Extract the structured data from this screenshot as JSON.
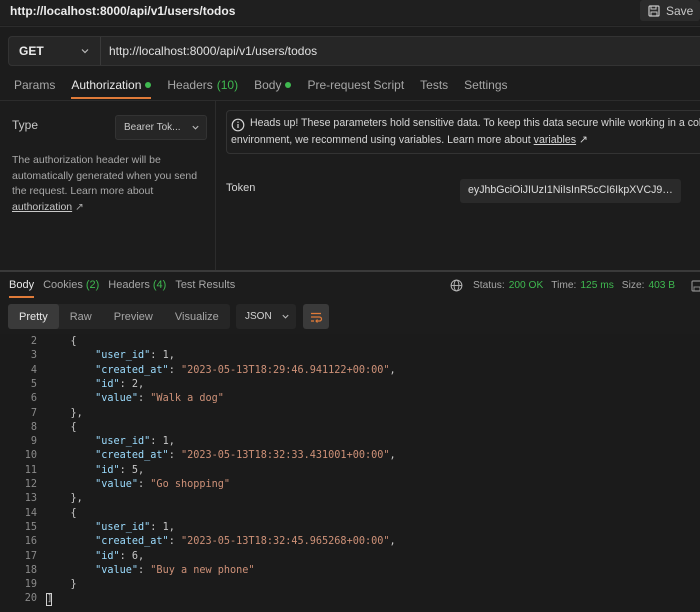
{
  "window": {
    "title": "http://localhost:8000/api/v1/users/todos",
    "save_label": "Save"
  },
  "request": {
    "method": "GET",
    "url": "http://localhost:8000/api/v1/users/todos"
  },
  "request_tabs": [
    {
      "label": "Params"
    },
    {
      "label": "Authorization"
    },
    {
      "label": "Headers",
      "count": "(10)"
    },
    {
      "label": "Body"
    },
    {
      "label": "Pre-request Script"
    },
    {
      "label": "Tests"
    },
    {
      "label": "Settings"
    }
  ],
  "auth": {
    "type_label": "Type",
    "type_value": "Bearer Tok...",
    "desc_1": "The authorization header will be automatically generated when you send the request. Learn more about ",
    "desc_link": "authorization",
    "notice_line1": "Heads up! These parameters hold sensitive data. To keep this data secure while working in a collabor",
    "notice_line2": "environment, we recommend using variables. Learn more about ",
    "notice_link": "variables",
    "token_label": "Token",
    "token_value": "eyJhbGciOiJIUzI1NiIsInR5cCI6IkpXVCJ9.ey..."
  },
  "response_tabs": [
    {
      "label": "Body"
    },
    {
      "label": "Cookies",
      "count": "(2)"
    },
    {
      "label": "Headers",
      "count": "(4)"
    },
    {
      "label": "Test Results"
    }
  ],
  "status": {
    "status_label": "Status:",
    "status_value": "200 OK",
    "time_label": "Time:",
    "time_value": "125 ms",
    "size_label": "Size:",
    "size_value": "403 B",
    "save_truncated": "Sa"
  },
  "views": [
    "Pretty",
    "Raw",
    "Preview",
    "Visualize"
  ],
  "format": "JSON",
  "code_lines": [
    {
      "n": "2",
      "text": "    {"
    },
    {
      "n": "3",
      "key": "\"user_id\"",
      "val": "1",
      "kind": "num"
    },
    {
      "n": "4",
      "key": "\"created_at\"",
      "val": "\"2023-05-13T18:29:46.941122+00:00\"",
      "kind": "str"
    },
    {
      "n": "5",
      "key": "\"id\"",
      "val": "2",
      "kind": "num"
    },
    {
      "n": "6",
      "key": "\"value\"",
      "val": "\"Walk a dog\"",
      "kind": "str",
      "last": true
    },
    {
      "n": "7",
      "text": "    },"
    },
    {
      "n": "8",
      "text": "    {"
    },
    {
      "n": "9",
      "key": "\"user_id\"",
      "val": "1",
      "kind": "num"
    },
    {
      "n": "10",
      "key": "\"created_at\"",
      "val": "\"2023-05-13T18:32:33.431001+00:00\"",
      "kind": "str"
    },
    {
      "n": "11",
      "key": "\"id\"",
      "val": "5",
      "kind": "num"
    },
    {
      "n": "12",
      "key": "\"value\"",
      "val": "\"Go shopping\"",
      "kind": "str",
      "last": true
    },
    {
      "n": "13",
      "text": "    },"
    },
    {
      "n": "14",
      "text": "    {"
    },
    {
      "n": "15",
      "key": "\"user_id\"",
      "val": "1",
      "kind": "num"
    },
    {
      "n": "16",
      "key": "\"created_at\"",
      "val": "\"2023-05-13T18:32:45.965268+00:00\"",
      "kind": "str"
    },
    {
      "n": "17",
      "key": "\"id\"",
      "val": "6",
      "kind": "num"
    },
    {
      "n": "18",
      "key": "\"value\"",
      "val": "\"Buy a new phone\"",
      "kind": "str",
      "last": true
    },
    {
      "n": "19",
      "text": "    }"
    },
    {
      "n": "20",
      "text": "]",
      "cursor": true
    }
  ]
}
